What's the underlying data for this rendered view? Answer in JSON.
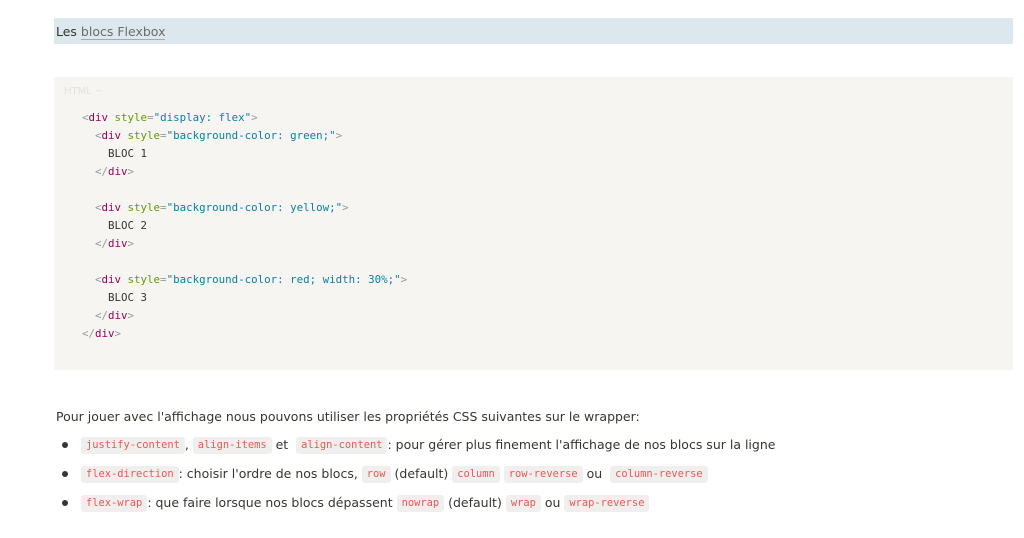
{
  "header": {
    "prefix": "Les ",
    "link_text": "blocs Flexbox"
  },
  "code_block": {
    "language": "HTML ~",
    "lines": [
      [
        {
          "t": "<",
          "c": "punc"
        },
        {
          "t": "div",
          "c": "tag"
        },
        {
          "t": " style",
          "c": "attr"
        },
        {
          "t": "=",
          "c": "punc"
        },
        {
          "t": "\"display: flex\"",
          "c": "str"
        },
        {
          "t": ">",
          "c": "punc"
        }
      ],
      [
        {
          "t": "  <",
          "c": "punc"
        },
        {
          "t": "div",
          "c": "tag"
        },
        {
          "t": " style",
          "c": "attr"
        },
        {
          "t": "=",
          "c": "punc"
        },
        {
          "t": "\"background-color: green;\"",
          "c": "str"
        },
        {
          "t": ">",
          "c": "punc"
        }
      ],
      [
        {
          "t": "    BLOC 1",
          "c": "text"
        }
      ],
      [
        {
          "t": "  </",
          "c": "punc"
        },
        {
          "t": "div",
          "c": "tag"
        },
        {
          "t": ">",
          "c": "punc"
        }
      ],
      [],
      [
        {
          "t": "  <",
          "c": "punc"
        },
        {
          "t": "div",
          "c": "tag"
        },
        {
          "t": " style",
          "c": "attr"
        },
        {
          "t": "=",
          "c": "punc"
        },
        {
          "t": "\"background-color: yellow;\"",
          "c": "str"
        },
        {
          "t": ">",
          "c": "punc"
        }
      ],
      [
        {
          "t": "    BLOC 2",
          "c": "text"
        }
      ],
      [
        {
          "t": "  </",
          "c": "punc"
        },
        {
          "t": "div",
          "c": "tag"
        },
        {
          "t": ">",
          "c": "punc"
        }
      ],
      [],
      [
        {
          "t": "  <",
          "c": "punc"
        },
        {
          "t": "div",
          "c": "tag"
        },
        {
          "t": " style",
          "c": "attr"
        },
        {
          "t": "=",
          "c": "punc"
        },
        {
          "t": "\"background-color: red; width: 30%;\"",
          "c": "str"
        },
        {
          "t": ">",
          "c": "punc"
        }
      ],
      [
        {
          "t": "    BLOC 3",
          "c": "text"
        }
      ],
      [
        {
          "t": "  </",
          "c": "punc"
        },
        {
          "t": "div",
          "c": "tag"
        },
        {
          "t": ">",
          "c": "punc"
        }
      ],
      [
        {
          "t": "</",
          "c": "punc"
        },
        {
          "t": "div",
          "c": "tag"
        },
        {
          "t": ">",
          "c": "punc"
        }
      ]
    ]
  },
  "intro": "Pour jouer avec l'affichage nous pouvons utiliser les propriétés CSS suivantes sur le wrapper:",
  "bullets": [
    [
      {
        "type": "code",
        "text": "justify-content"
      },
      {
        "type": "text",
        "text": ", "
      },
      {
        "type": "code",
        "text": "align-items"
      },
      {
        "type": "text",
        "text": " et  "
      },
      {
        "type": "code",
        "text": "align-content"
      },
      {
        "type": "text",
        "text": ": pour gérer plus finement l'affichage de nos blocs sur la ligne"
      }
    ],
    [
      {
        "type": "code",
        "text": "flex-direction"
      },
      {
        "type": "text",
        "text": ": choisir l'ordre de nos blocs, "
      },
      {
        "type": "code",
        "text": "row"
      },
      {
        "type": "text",
        "text": " (default) "
      },
      {
        "type": "code",
        "text": "column"
      },
      {
        "type": "text",
        "text": " "
      },
      {
        "type": "code",
        "text": "row-reverse"
      },
      {
        "type": "text",
        "text": " ou  "
      },
      {
        "type": "code",
        "text": "column-reverse"
      }
    ],
    [
      {
        "type": "code",
        "text": "flex-wrap"
      },
      {
        "type": "text",
        "text": ": que faire lorsque nos blocs dépassent "
      },
      {
        "type": "code",
        "text": "nowrap"
      },
      {
        "type": "text",
        "text": " (default) "
      },
      {
        "type": "code",
        "text": "wrap"
      },
      {
        "type": "text",
        "text": " ou "
      },
      {
        "type": "code",
        "text": "wrap-reverse"
      }
    ]
  ]
}
